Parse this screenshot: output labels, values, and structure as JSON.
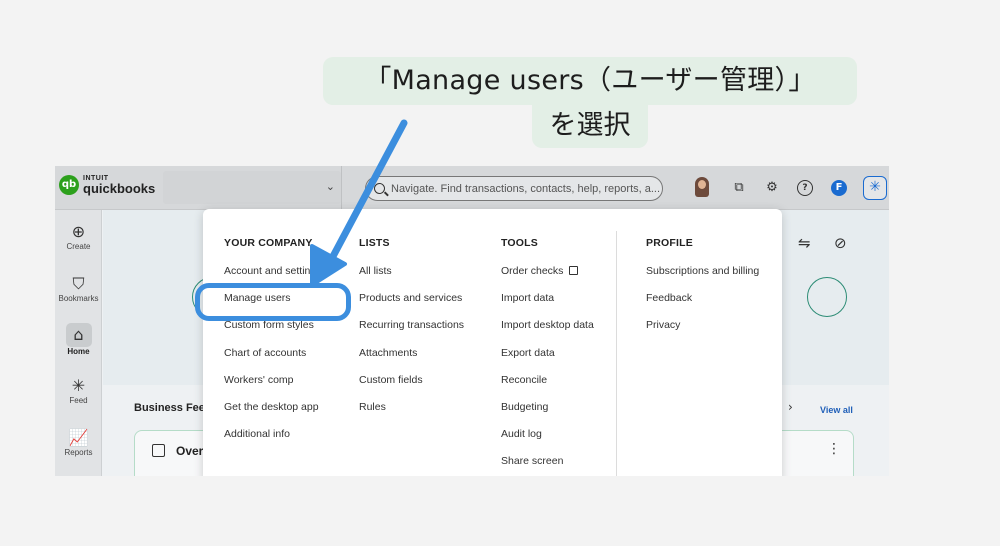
{
  "annotation": {
    "line1": "「Manage users（ユーザー管理）」",
    "line2": "を選択"
  },
  "topbar": {
    "logo_brand": "INTUIT",
    "logo_product": "quickbooks",
    "logo_mark": "qb",
    "search_placeholder": "Navigate. Find transactions, contacts, help, reports, a...",
    "profile_initial": "F"
  },
  "sidebar": {
    "items": [
      {
        "label": "Create",
        "icon": "plus-circle-icon",
        "glyph": "⊕"
      },
      {
        "label": "Bookmarks",
        "icon": "bookmark-icon",
        "glyph": "⛉"
      },
      {
        "label": "Home",
        "icon": "home-icon",
        "glyph": "⌂"
      },
      {
        "label": "Feed",
        "icon": "feed-icon",
        "glyph": "✳"
      },
      {
        "label": "Reports",
        "icon": "reports-icon",
        "glyph": "📈"
      }
    ]
  },
  "main": {
    "section_title": "Business Fee",
    "view_all": "View all",
    "card_title": "Over"
  },
  "menu": {
    "columns": [
      {
        "heading": "YOUR COMPANY",
        "items": [
          "Account and settings",
          "Manage users",
          "Custom form styles",
          "Chart of accounts",
          "Workers' comp",
          "Get the desktop app",
          "Additional info"
        ]
      },
      {
        "heading": "LISTS",
        "items": [
          "All lists",
          "Products and services",
          "Recurring transactions",
          "Attachments",
          "Custom fields",
          "Rules"
        ]
      },
      {
        "heading": "TOOLS",
        "items": [
          "Order checks",
          "Import data",
          "Import desktop data",
          "Export data",
          "Reconcile",
          "Budgeting",
          "Audit log",
          "Share screen"
        ]
      },
      {
        "heading": "PROFILE",
        "items": [
          "Subscriptions and billing",
          "Feedback",
          "Privacy"
        ]
      }
    ]
  },
  "colors": {
    "highlight": "#3c8ede",
    "callout_bg": "#e3efe6"
  }
}
